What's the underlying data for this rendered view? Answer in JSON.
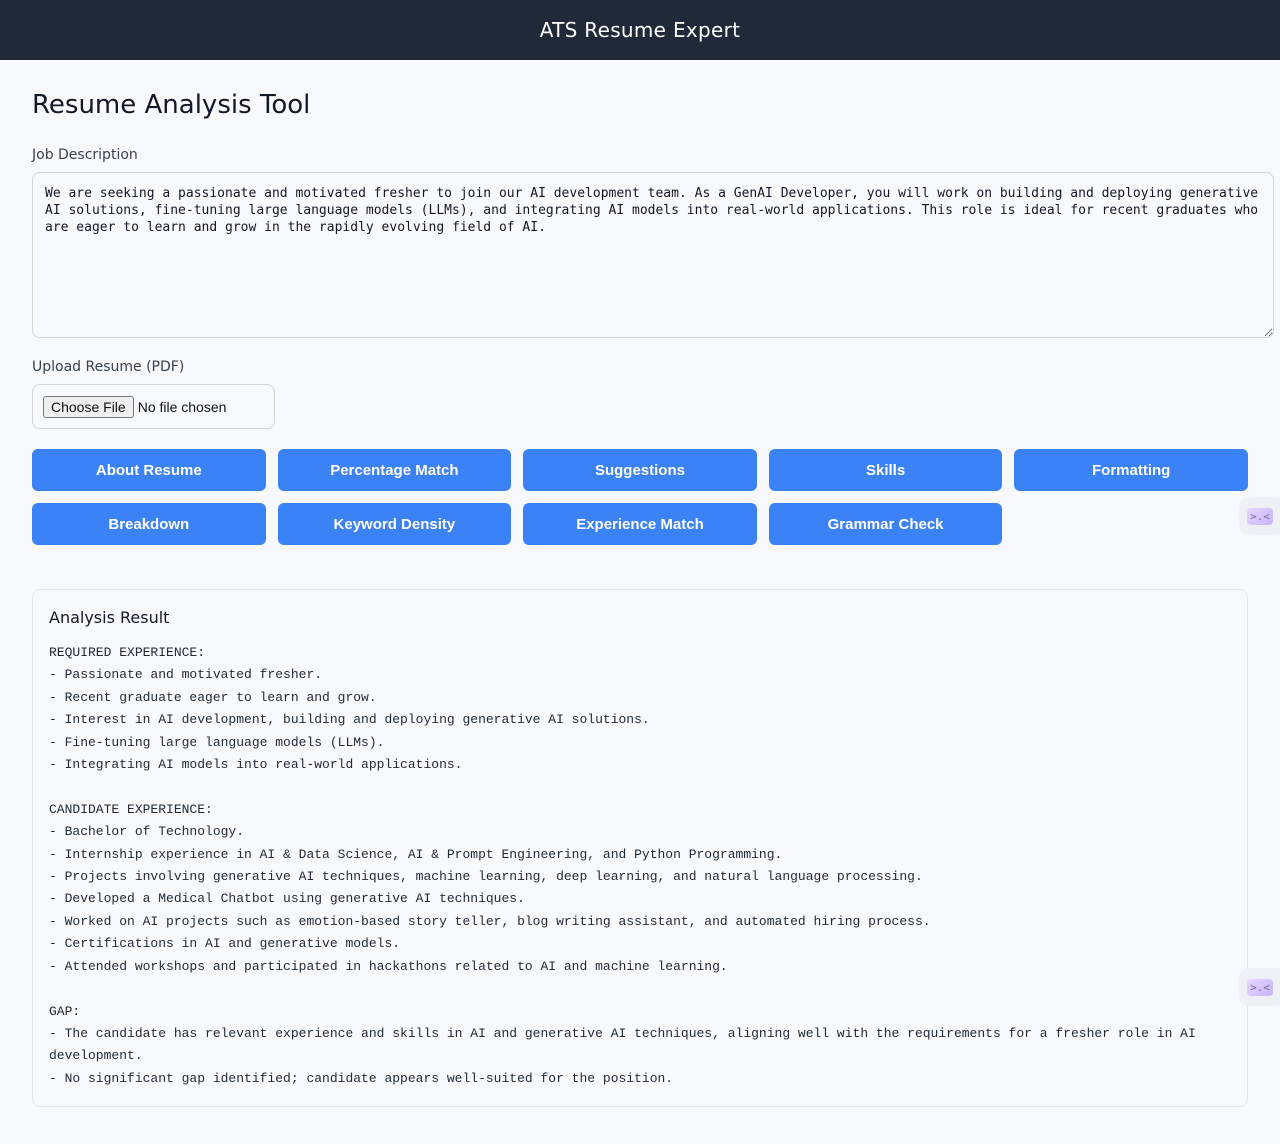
{
  "app": {
    "title": "ATS Resume Expert"
  },
  "page": {
    "heading": "Resume Analysis Tool"
  },
  "job_description": {
    "label": "Job Description",
    "value": "We are seeking a passionate and motivated fresher to join our AI development team. As a GenAI Developer, you will work on building and deploying generative AI solutions, fine-tuning large language models (LLMs), and integrating AI models into real-world applications. This role is ideal for recent graduates who are eager to learn and grow in the rapidly evolving field of AI."
  },
  "upload": {
    "label": "Upload Resume (PDF)",
    "button_label": "Choose File",
    "status": "No file chosen"
  },
  "actions": [
    {
      "label": "About Resume"
    },
    {
      "label": "Percentage Match"
    },
    {
      "label": "Suggestions"
    },
    {
      "label": "Skills"
    },
    {
      "label": "Formatting"
    },
    {
      "label": "Breakdown"
    },
    {
      "label": "Keyword Density"
    },
    {
      "label": "Experience Match"
    },
    {
      "label": "Grammar Check"
    }
  ],
  "result": {
    "title": "Analysis Result",
    "body": "REQUIRED EXPERIENCE:\n- Passionate and motivated fresher.\n- Recent graduate eager to learn and grow.\n- Interest in AI development, building and deploying generative AI solutions.\n- Fine-tuning large language models (LLMs).\n- Integrating AI models into real-world applications.\n\nCANDIDATE EXPERIENCE:\n- Bachelor of Technology.\n- Internship experience in AI & Data Science, AI & Prompt Engineering, and Python Programming.\n- Projects involving generative AI techniques, machine learning, deep learning, and natural language processing.\n- Developed a Medical Chatbot using generative AI techniques.\n- Worked on AI projects such as emotion-based story teller, blog writing assistant, and automated hiring process.\n- Certifications in AI and generative models.\n- Attended workshops and participated in hackathons related to AI and machine learning.\n\nGAP:\n- The candidate has relevant experience and skills in AI and generative AI techniques, aligning well with the requirements for a fresher role in AI development.\n- No significant gap identified; candidate appears well-suited for the position."
  },
  "side_widgets": [
    {
      "glyph": ">.<",
      "icon": "extension-icon"
    },
    {
      "glyph": ">.<",
      "icon": "extension-icon"
    }
  ]
}
